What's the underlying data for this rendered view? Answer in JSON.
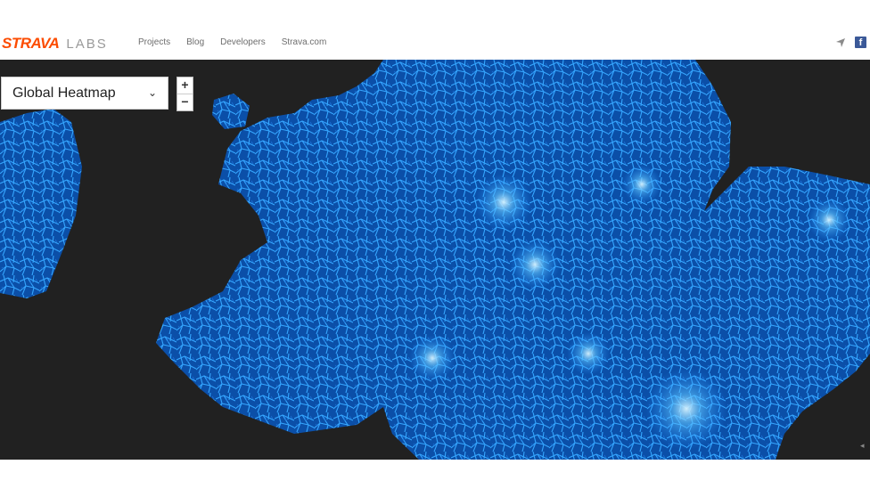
{
  "brand": {
    "name": "STRAVA",
    "sub": "LABS"
  },
  "nav": {
    "items": [
      "Projects",
      "Blog",
      "Developers",
      "Strava.com"
    ]
  },
  "header_icons": {
    "locate": "location-arrow-icon",
    "facebook": "f"
  },
  "map": {
    "layer_selector": {
      "selected": "Global Heatmap"
    },
    "zoom": {
      "in": "+",
      "out": "−"
    },
    "colors": {
      "background": "#212121",
      "heat": "#1e90ff",
      "heat_bright": "#7fd4ff"
    }
  }
}
